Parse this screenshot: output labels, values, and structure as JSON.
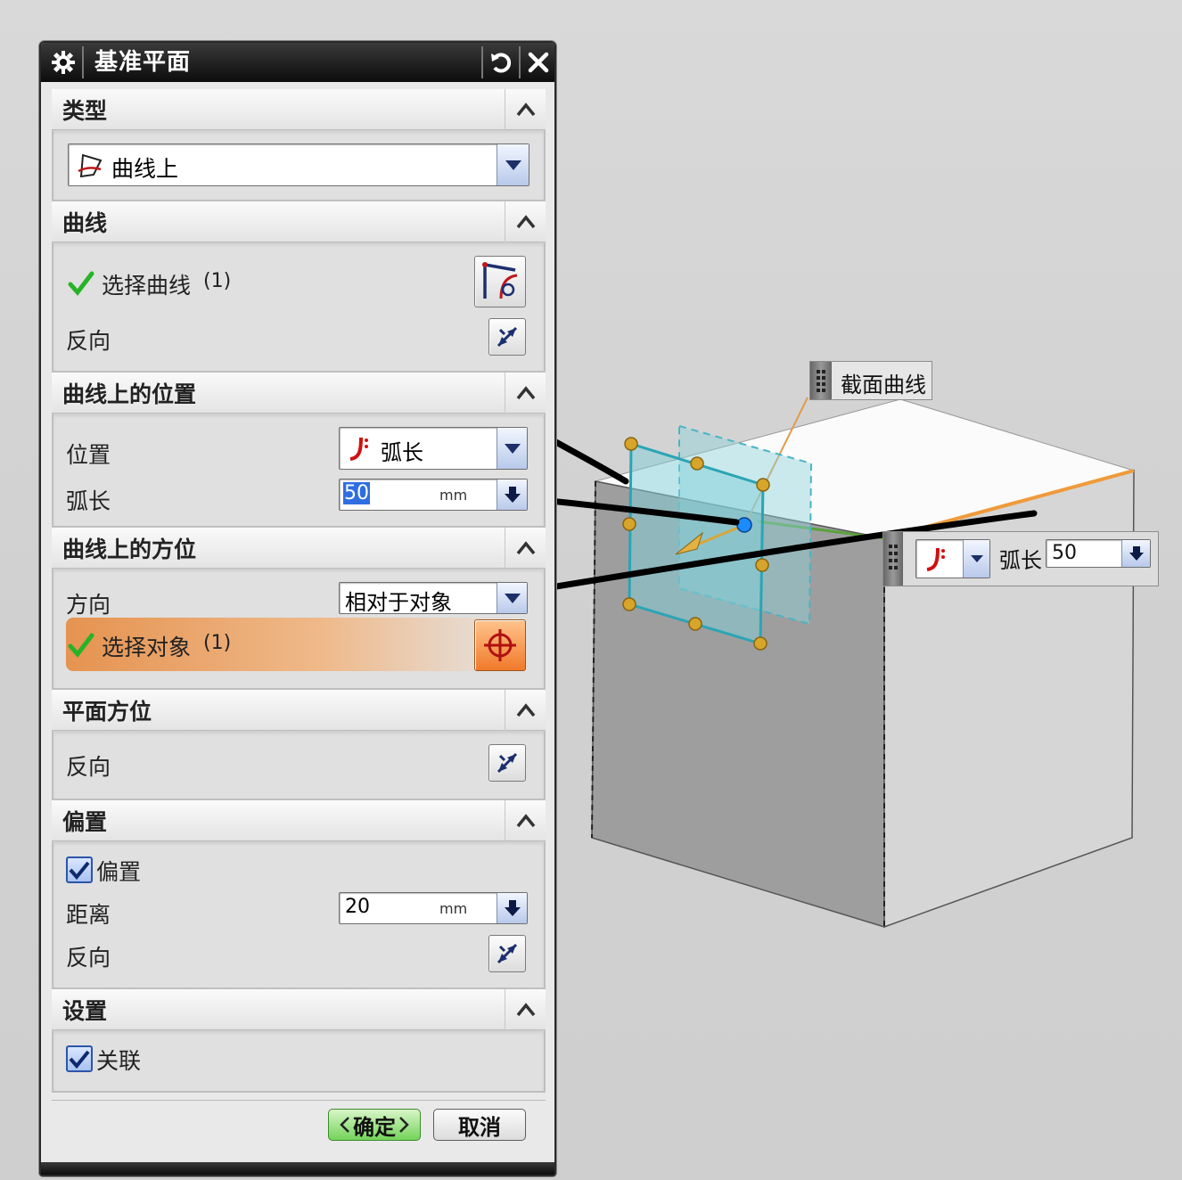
{
  "dialog": {
    "title": "基准平面",
    "groups": {
      "type": {
        "header": "类型",
        "selected": "曲线上"
      },
      "curve": {
        "header": "曲线",
        "select_label": "选择曲线",
        "select_count": "(1)",
        "reverse_label": "反向"
      },
      "position": {
        "header": "曲线上的位置",
        "position_label": "位置",
        "position_value": "弧长",
        "arclength_label": "弧长",
        "arclength_value": "50",
        "arclength_unit": "mm"
      },
      "orientation": {
        "header": "曲线上的方位",
        "direction_label": "方向",
        "direction_value": "相对于对象",
        "select_object_label": "选择对象",
        "select_object_count": "(1)"
      },
      "plane_orientation": {
        "header": "平面方位",
        "reverse_label": "反向"
      },
      "offset": {
        "header": "偏置",
        "offset_checkbox_label": "偏置",
        "distance_label": "距离",
        "distance_value": "20",
        "distance_unit": "mm",
        "reverse_label": "反向"
      },
      "settings": {
        "header": "设置",
        "associative_label": "关联"
      }
    },
    "ok_label": "确定",
    "cancel_label": "取消"
  },
  "graphics": {
    "section_curve_label": "截面曲线",
    "arclength_label": "弧长",
    "arclength_value": "50"
  },
  "colors": {
    "titlebar": "#111111",
    "highlight": "#e8914f",
    "check_green": "#27b327",
    "plane_cyan": "#3fb6c6",
    "edge_orange": "#f09a3a"
  },
  "icons": [
    "gear-icon",
    "reset-icon",
    "close-icon",
    "collapse-icon",
    "dropdown-arrow-icon",
    "curve-on-icon",
    "arc-length-icon",
    "reverse-direction-icon",
    "select-curve-icon",
    "crosshair-icon",
    "checkmark-icon"
  ]
}
